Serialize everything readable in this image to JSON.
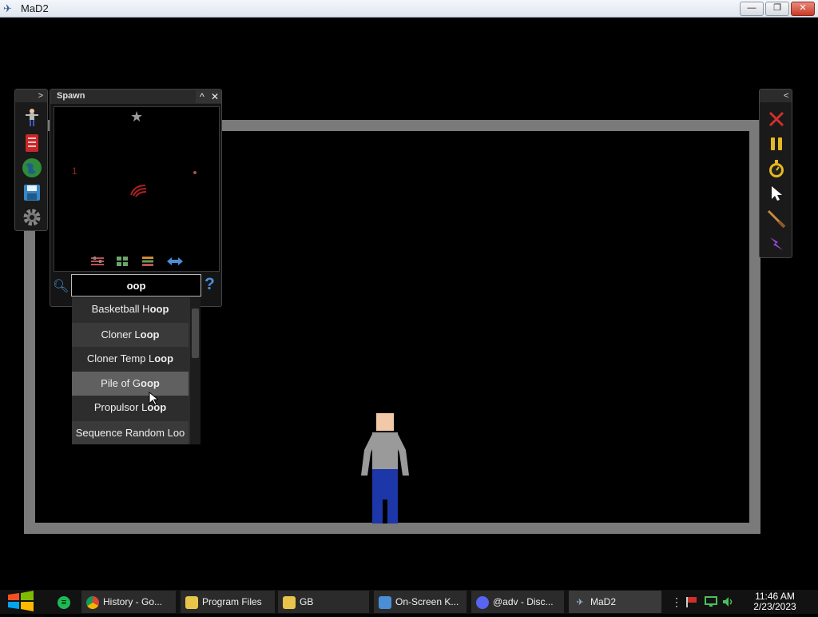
{
  "window": {
    "title": "MaD2",
    "minimize": "—",
    "restore": "❐",
    "close": "✕"
  },
  "left_toolbar": {
    "collapse": ">"
  },
  "spawn_panel": {
    "title": "Spawn",
    "minimize": "^",
    "close": "✕"
  },
  "preview": {
    "label_1": "1"
  },
  "search": {
    "value": "oop",
    "help": "?"
  },
  "dropdown": {
    "items": [
      {
        "pre": "Basketball H",
        "match": "oop"
      },
      {
        "pre": "Cloner L",
        "match": "oop"
      },
      {
        "pre": "Cloner Temp L",
        "match": "oop"
      },
      {
        "pre": "Pile of G",
        "match": "oop"
      },
      {
        "pre": "Propulsor L",
        "match": "oop"
      },
      {
        "pre": "Sequence Random Loo",
        "match": ""
      }
    ]
  },
  "right_toolbar": {
    "collapse": "<"
  },
  "taskbar": {
    "items": [
      {
        "label": "History - Go...",
        "icon": "chrome-icon"
      },
      {
        "label": "Program Files",
        "icon": "folder-icon"
      },
      {
        "label": "GB",
        "icon": "folder-icon"
      },
      {
        "label": "On-Screen K...",
        "icon": "keyboard-icon"
      },
      {
        "label": "@adv - Disc...",
        "icon": "discord-icon"
      },
      {
        "label": "MaD2",
        "icon": "mad2-icon"
      }
    ],
    "time": "11:46 AM",
    "date": "2/23/2023"
  },
  "colors": {
    "accent_blue": "#4a8fd6",
    "arena_gray": "#7a7a7a",
    "close_red": "#d0302a"
  }
}
